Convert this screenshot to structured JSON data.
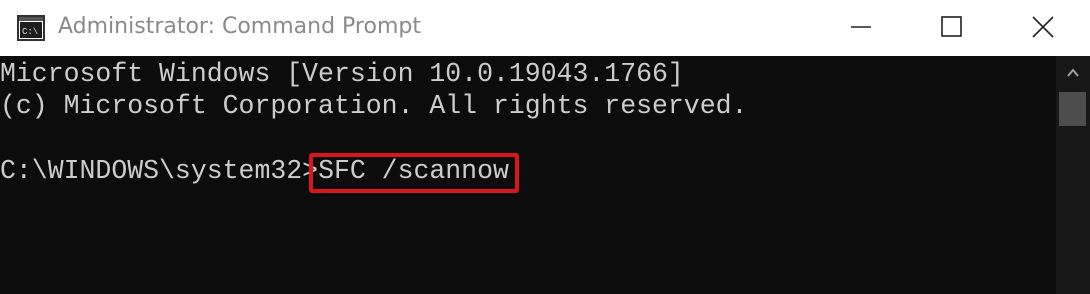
{
  "window": {
    "title": "Administrator: Command Prompt",
    "icon": "cmd-icon",
    "controls": [
      "minimize-icon",
      "maximize-icon",
      "close-icon"
    ]
  },
  "console": {
    "lines": [
      "Microsoft Windows [Version 10.0.19043.1766]",
      "(c) Microsoft Corporation. All rights reserved.",
      ""
    ],
    "prompt": "C:\\WINDOWS\\system32>",
    "command": "SFC /scannow",
    "highlight_color": "#d9161c",
    "text_color": "#cccccc",
    "background_color": "#0c0c0c"
  },
  "scrollbar": {
    "arrow_icon": "chevron-up-icon"
  }
}
